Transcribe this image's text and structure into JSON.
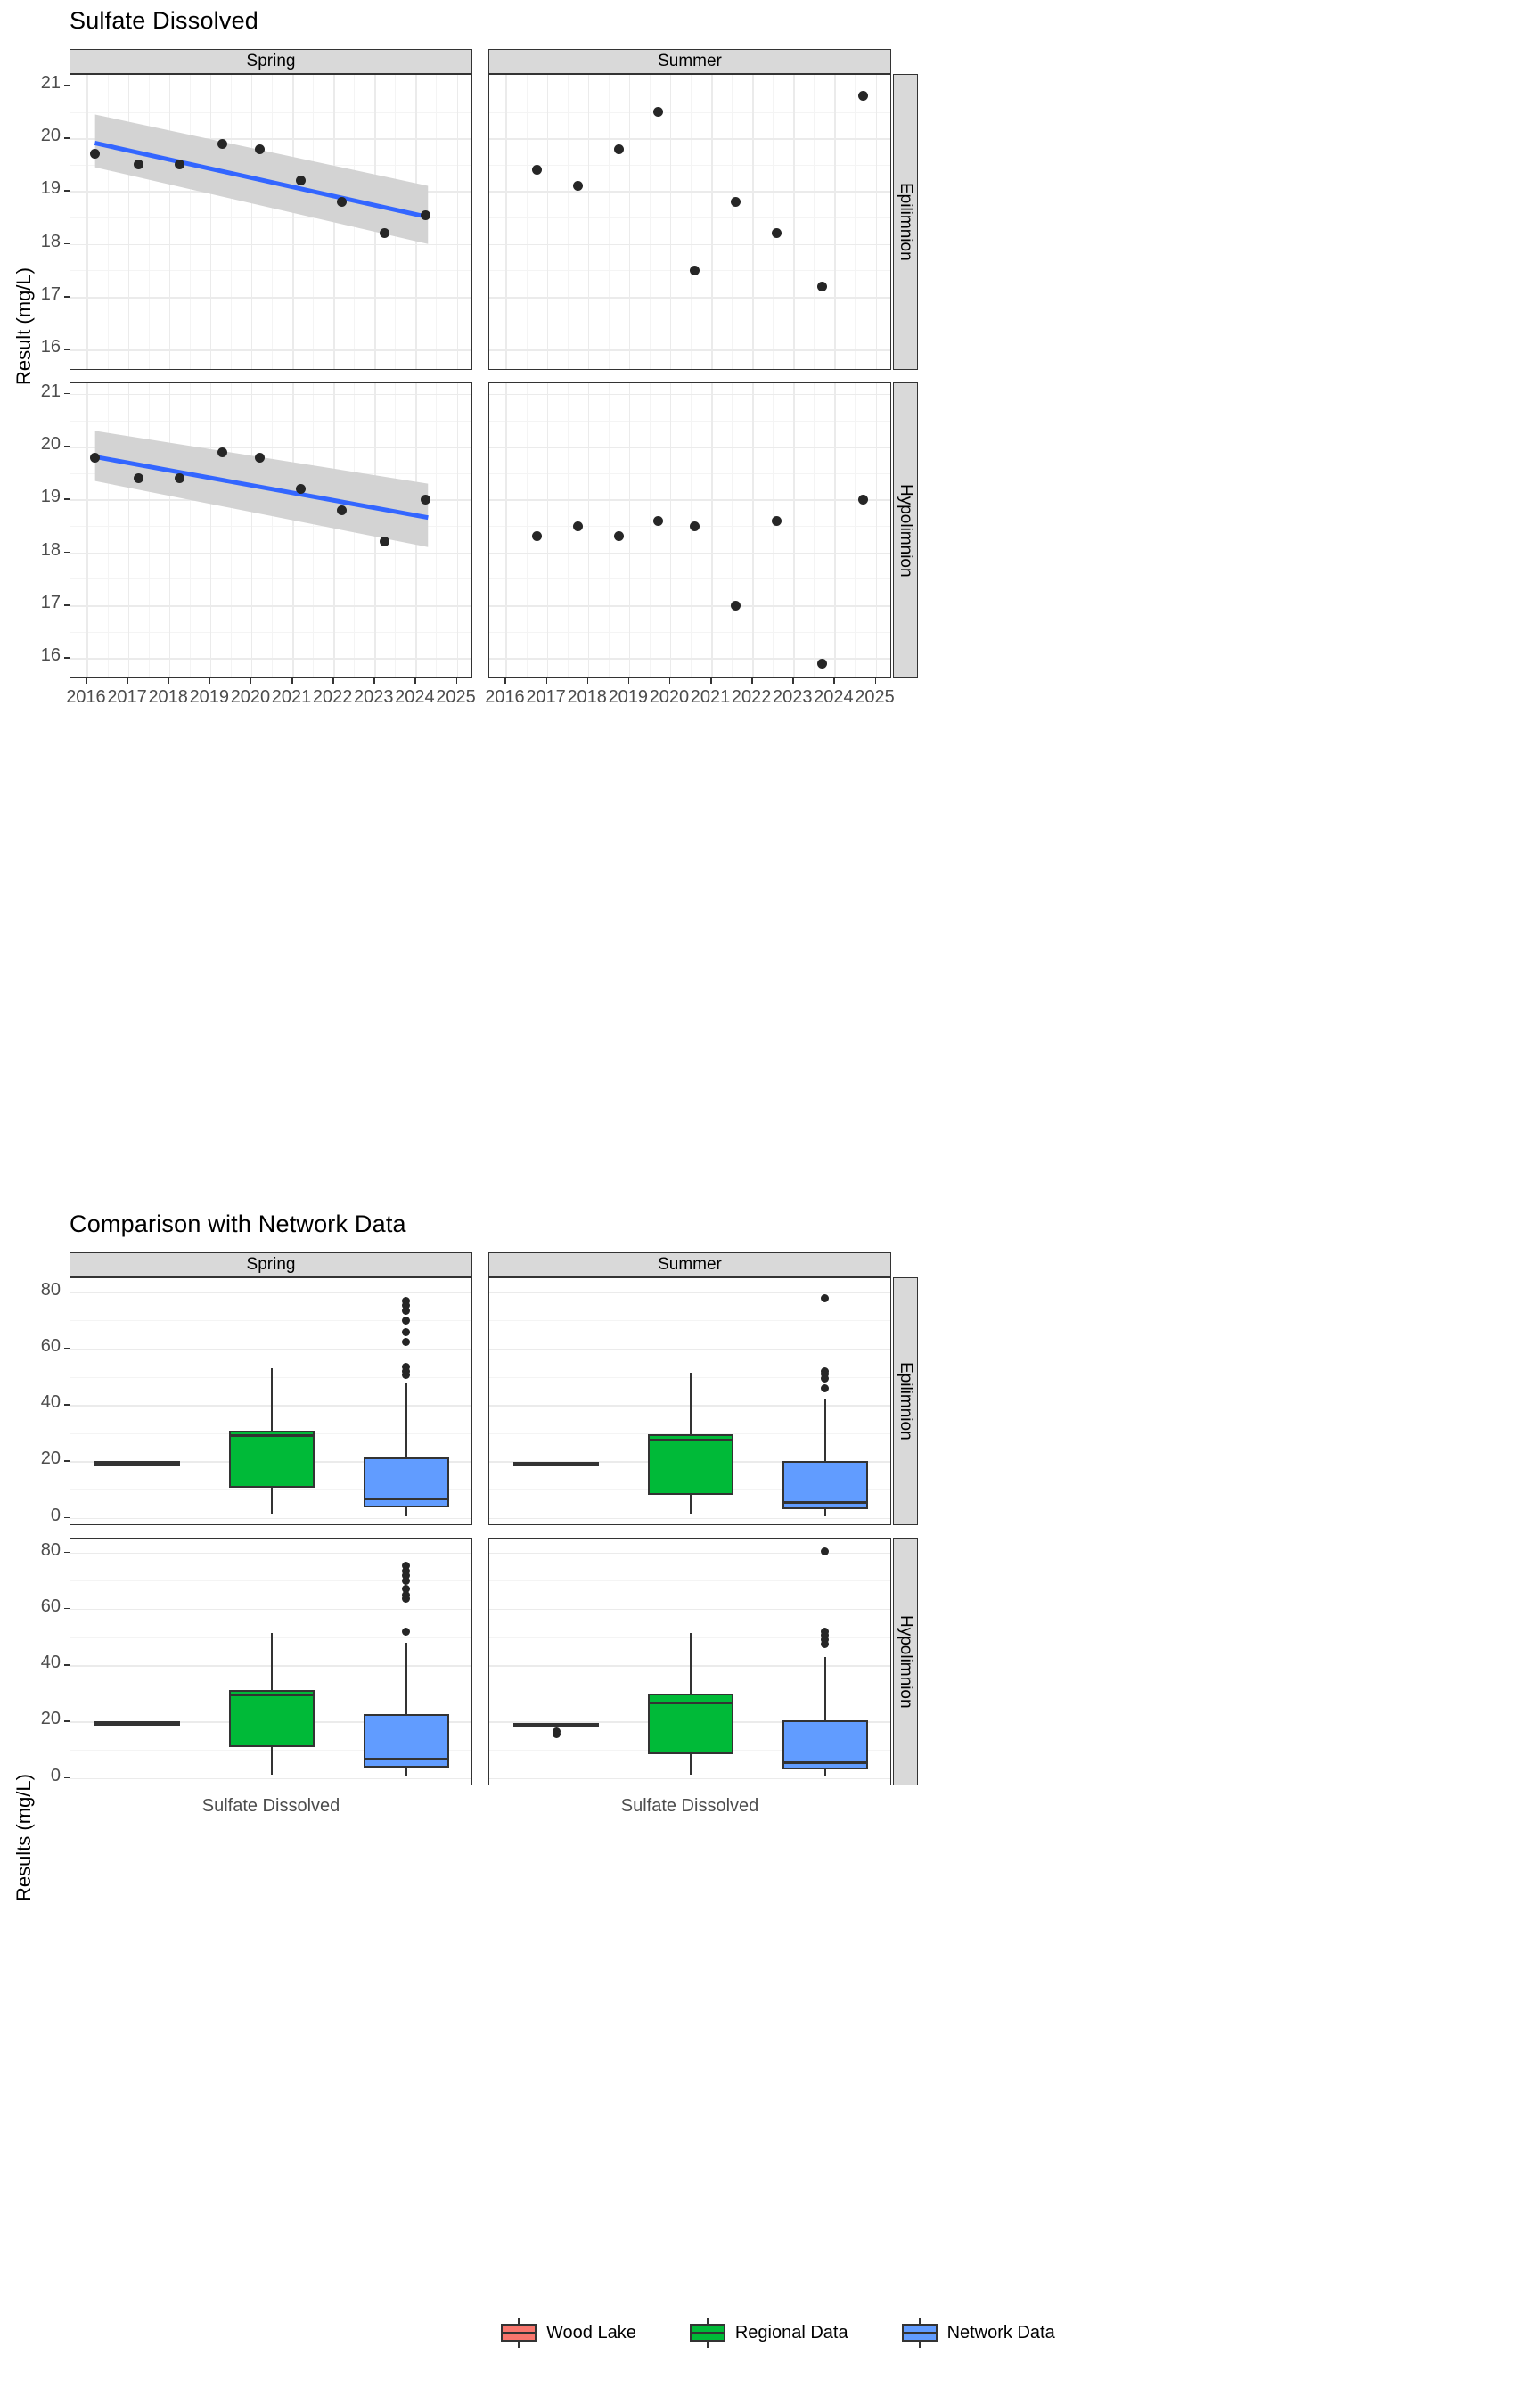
{
  "figure1": {
    "title": "Sulfate Dissolved",
    "ylabel": "Result (mg/L)",
    "col_strips": [
      "Spring",
      "Summer"
    ],
    "row_strips": [
      "Epilimnion",
      "Hypolimnion"
    ],
    "xticks": [
      "2016",
      "2017",
      "2018",
      "2019",
      "2020",
      "2021",
      "2022",
      "2023",
      "2024",
      "2025"
    ],
    "yticks_top": [
      "21",
      "20",
      "19",
      "18",
      "17",
      "16"
    ],
    "yticks_bottom": [
      "21",
      "20",
      "19",
      "18",
      "17",
      "16"
    ]
  },
  "figure2": {
    "title": "Comparison with Network Data",
    "ylabel": "Results (mg/L)",
    "col_strips": [
      "Spring",
      "Summer"
    ],
    "row_strips": [
      "Epilimnion",
      "Hypolimnion"
    ],
    "xtick": "Sulfate Dissolved",
    "yticks": [
      "80",
      "60",
      "40",
      "20",
      "0"
    ]
  },
  "legend": {
    "items": [
      {
        "label": "Wood Lake",
        "color": "#F8766D"
      },
      {
        "label": "Regional Data",
        "color": "#00BA38"
      },
      {
        "label": "Network Data",
        "color": "#619CFF"
      }
    ]
  },
  "chart_data": [
    {
      "type": "scatter",
      "title": "Sulfate Dissolved",
      "xlabel": "",
      "ylabel": "Result (mg/L)",
      "xlim": [
        2015.6,
        2025.4
      ],
      "ylim": [
        15.6,
        21.2
      ],
      "grid": true,
      "facets": [
        {
          "col": "Spring",
          "row": "Epilimnion",
          "x": [
            2016.2,
            2017.25,
            2018.25,
            2019.3,
            2020.2,
            2021.2,
            2022.2,
            2023.25,
            2024.25
          ],
          "y": [
            19.7,
            19.5,
            19.5,
            19.9,
            19.8,
            19.2,
            18.8,
            18.2,
            18.55
          ],
          "trend": {
            "x0": 2016.2,
            "y0": 19.95,
            "x1": 2024.3,
            "y1": 18.55,
            "color": "#3366ff"
          },
          "ci_band": {
            "x0": 2016.2,
            "upper0": 20.45,
            "lower0": 19.45,
            "x1": 2024.3,
            "upper1": 19.1,
            "lower1": 18.0,
            "color": "#d3d3d3"
          }
        },
        {
          "col": "Summer",
          "row": "Epilimnion",
          "x": [
            2016.75,
            2017.75,
            2018.75,
            2019.7,
            2020.6,
            2021.6,
            2022.6,
            2023.7,
            2024.7
          ],
          "y": [
            19.4,
            19.1,
            19.8,
            20.5,
            17.5,
            18.8,
            18.2,
            17.2,
            20.8
          ],
          "trend": null,
          "ci_band": null
        },
        {
          "col": "Spring",
          "row": "Hypolimnion",
          "x": [
            2016.2,
            2017.25,
            2018.25,
            2019.3,
            2020.2,
            2021.2,
            2022.2,
            2023.25,
            2024.25
          ],
          "y": [
            19.8,
            19.4,
            19.4,
            19.9,
            19.8,
            19.2,
            18.8,
            18.2,
            19.0
          ],
          "trend": {
            "x0": 2016.2,
            "y0": 19.85,
            "x1": 2024.3,
            "y1": 18.7,
            "color": "#3366ff"
          },
          "ci_band": {
            "x0": 2016.2,
            "upper0": 20.3,
            "lower0": 19.35,
            "x1": 2024.3,
            "upper1": 19.3,
            "lower1": 18.1,
            "color": "#d3d3d3"
          }
        },
        {
          "col": "Summer",
          "row": "Hypolimnion",
          "x": [
            2016.75,
            2017.75,
            2018.75,
            2019.7,
            2020.6,
            2021.6,
            2022.6,
            2023.7,
            2024.7
          ],
          "y": [
            18.3,
            18.5,
            18.3,
            18.6,
            18.5,
            17.0,
            18.6,
            15.9,
            19.0
          ],
          "trend": null,
          "ci_band": null
        }
      ]
    },
    {
      "type": "boxplot",
      "title": "Comparison with Network Data",
      "xlabel": "Sulfate Dissolved",
      "ylabel": "Results (mg/L)",
      "ylim": [
        -3,
        85
      ],
      "grid": true,
      "groups": [
        "Wood Lake",
        "Regional Data",
        "Network Data"
      ],
      "facets": [
        {
          "col": "Spring",
          "row": "Epilimnion",
          "boxes": [
            {
              "group": "Wood Lake",
              "min": 19.2,
              "q1": 19.3,
              "median": 19.5,
              "q3": 19.6,
              "max": 19.7,
              "outliers": []
            },
            {
              "group": "Regional Data",
              "min": 1.0,
              "q1": 10.5,
              "median": 29.0,
              "q3": 31.0,
              "max": 53.0,
              "outliers": []
            },
            {
              "group": "Network Data",
              "min": 0.5,
              "q1": 3.5,
              "median": 6.5,
              "q3": 21.5,
              "max": 48.0,
              "outliers": [
                77.0,
                75.5,
                73.5,
                70.0,
                66.0,
                62.5,
                53.5,
                52.0,
                50.5
              ]
            }
          ]
        },
        {
          "col": "Summer",
          "row": "Epilimnion",
          "boxes": [
            {
              "group": "Wood Lake",
              "min": 18.5,
              "q1": 18.7,
              "median": 19.4,
              "q3": 19.6,
              "max": 19.8,
              "outliers": []
            },
            {
              "group": "Regional Data",
              "min": 1.0,
              "q1": 8.0,
              "median": 27.5,
              "q3": 29.5,
              "max": 51.5,
              "outliers": []
            },
            {
              "group": "Network Data",
              "min": 0.5,
              "q1": 3.0,
              "median": 5.5,
              "q3": 20.0,
              "max": 42.0,
              "outliers": [
                78.0,
                52.0,
                51.0,
                49.5,
                46.0
              ]
            }
          ]
        },
        {
          "col": "Spring",
          "row": "Hypolimnion",
          "boxes": [
            {
              "group": "Wood Lake",
              "min": 19.3,
              "q1": 19.4,
              "median": 19.6,
              "q3": 19.7,
              "max": 19.9,
              "outliers": []
            },
            {
              "group": "Regional Data",
              "min": 1.0,
              "q1": 10.8,
              "median": 29.5,
              "q3": 31.2,
              "max": 51.5,
              "outliers": []
            },
            {
              "group": "Network Data",
              "min": 0.5,
              "q1": 3.5,
              "median": 6.5,
              "q3": 22.5,
              "max": 48.0,
              "outliers": [
                75.5,
                73.5,
                72.0,
                70.0,
                67.0,
                65.0,
                63.5,
                52.0
              ]
            }
          ]
        },
        {
          "col": "Summer",
          "row": "Hypolimnion",
          "boxes": [
            {
              "group": "Wood Lake",
              "min": 18.2,
              "q1": 18.6,
              "median": 19.0,
              "q3": 19.2,
              "max": 19.4,
              "outliers": [
                16.5,
                15.5
              ]
            },
            {
              "group": "Regional Data",
              "min": 1.0,
              "q1": 8.5,
              "median": 26.5,
              "q3": 29.8,
              "max": 51.5,
              "outliers": []
            },
            {
              "group": "Network Data",
              "min": 0.5,
              "q1": 3.0,
              "median": 5.5,
              "q3": 20.5,
              "max": 43.0,
              "outliers": [
                80.5,
                52.0,
                50.5,
                49.0,
                47.5
              ]
            }
          ]
        }
      ]
    }
  ]
}
